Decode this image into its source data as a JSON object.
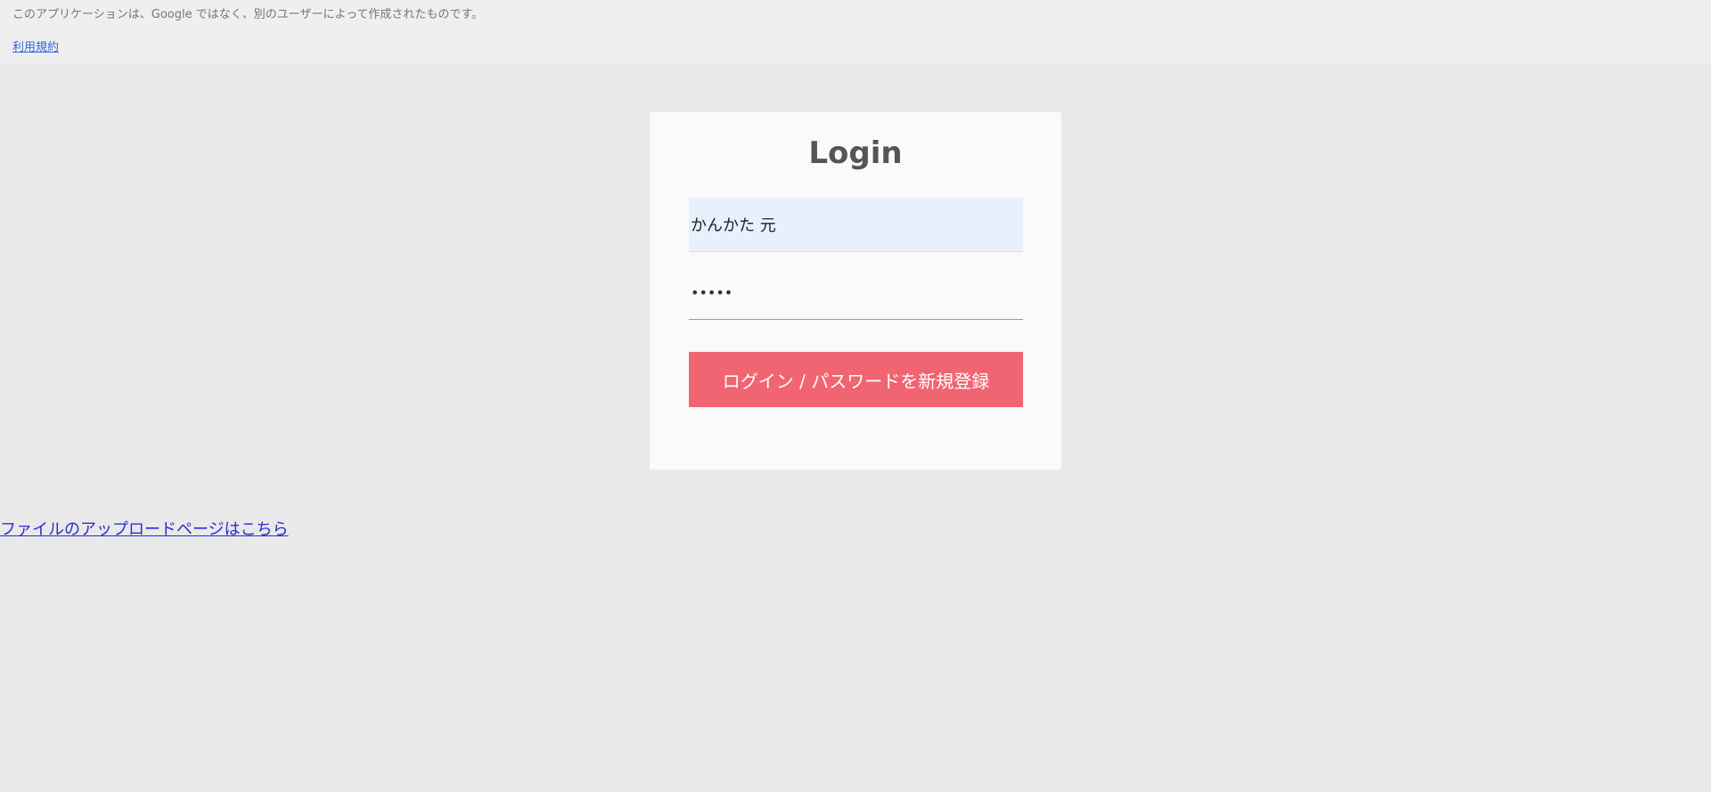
{
  "banner": {
    "notice": "このアプリケーションは、Google ではなく、別のユーザーによって作成されたものです。",
    "terms_link": "利用規約"
  },
  "login": {
    "title": "Login",
    "username_value": "かんかた 元",
    "password_value": "•••••",
    "submit_label": "ログイン / パスワードを新規登録"
  },
  "footer": {
    "upload_link": "ファイルのアップロードページはこちら"
  },
  "colors": {
    "background": "#e9e9e9",
    "banner_background": "#efefef",
    "card_background": "#fafafa",
    "autofill_background": "#e8f0fe",
    "button_accent": "#f16472",
    "link_color": "#2b2bd8"
  }
}
